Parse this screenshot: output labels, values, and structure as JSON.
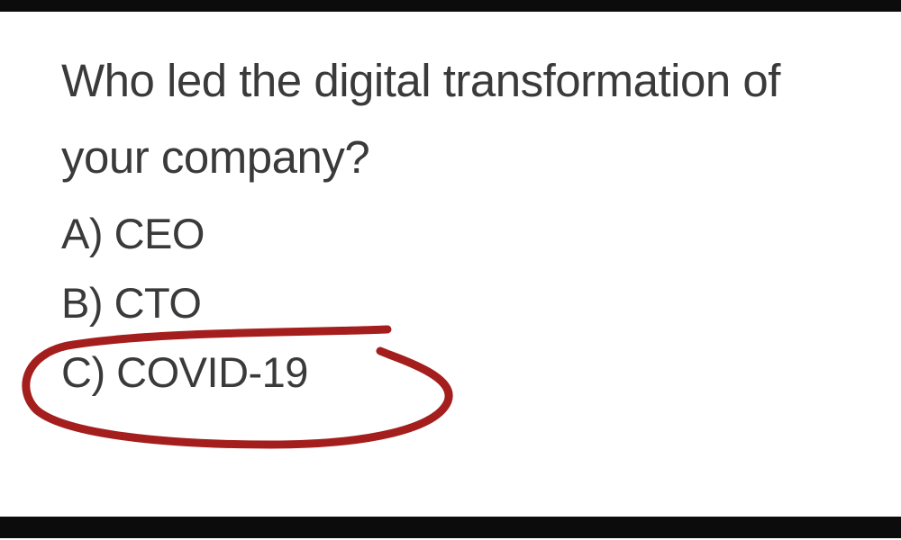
{
  "quiz": {
    "question": "Who led the digital transformation of your company?",
    "options": [
      {
        "letter": "A)",
        "text": "CEO"
      },
      {
        "letter": "B)",
        "text": "CTO"
      },
      {
        "letter": "C)",
        "text": "COVID-19",
        "circled": true
      }
    ]
  },
  "colors": {
    "text": "#3a3a3a",
    "annotation": "#a51e1e",
    "frame": "#0c0c0c"
  }
}
